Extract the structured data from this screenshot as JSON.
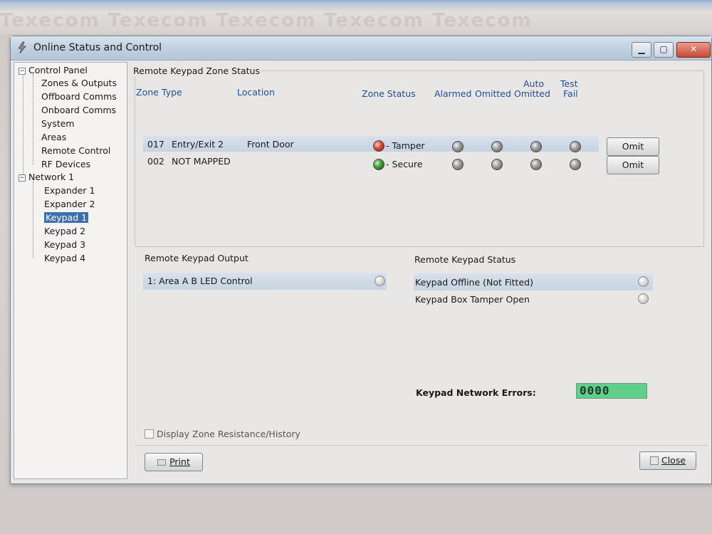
{
  "window": {
    "title": "Online Status and Control",
    "controls": {
      "minimize": "▁",
      "maximize": "▢",
      "close": "✕"
    }
  },
  "tree": {
    "root_label": "Control Panel",
    "root_children": [
      "Zones & Outputs",
      "Offboard Comms",
      "Onboard Comms",
      "System",
      "Areas",
      "Remote Control",
      "RF Devices"
    ],
    "network_label": "Network 1",
    "network_children": [
      "Expander 1",
      "Expander 2",
      "Keypad 1",
      "Keypad 2",
      "Keypad 3",
      "Keypad 4"
    ],
    "selected": "Keypad 1",
    "expander_glyph": "−"
  },
  "zone_status": {
    "group_title": "Remote Keypad Zone Status",
    "headers": {
      "zone": "Zone",
      "type": "Type",
      "location": "Location",
      "zone_status": "Zone Status",
      "alarmed": "Alarmed",
      "omitted": "Omitted",
      "auto_omitted_1": "Auto",
      "auto_omitted_2": "Omitted",
      "test_fail_1": "Test",
      "test_fail_2": "Fail"
    },
    "rows": [
      {
        "zone": "017",
        "type": "Entry/Exit 2",
        "location": "Front Door",
        "status": "- Tamper",
        "status_color": "#e0442e",
        "omit_label": "Omit"
      },
      {
        "zone": "002",
        "type": "NOT MAPPED",
        "location": "",
        "status": "- Secure",
        "status_color": "#3e9a34",
        "omit_label": "Omit"
      }
    ]
  },
  "keypad_output": {
    "title": "Remote Keypad Output",
    "items": [
      {
        "label": "1: Area A B LED Control"
      }
    ]
  },
  "keypad_status": {
    "title": "Remote Keypad Status",
    "items": [
      {
        "label": "Keypad Offline (Not Fitted)"
      },
      {
        "label": "Keypad Box Tamper Open"
      }
    ]
  },
  "network_errors": {
    "label": "Keypad Network Errors:",
    "value": "0000"
  },
  "options": {
    "display_resistance_label": "Display Zone Resistance/History",
    "display_resistance_checked": false
  },
  "footer": {
    "print_label": "Print",
    "close_label": "Close"
  }
}
